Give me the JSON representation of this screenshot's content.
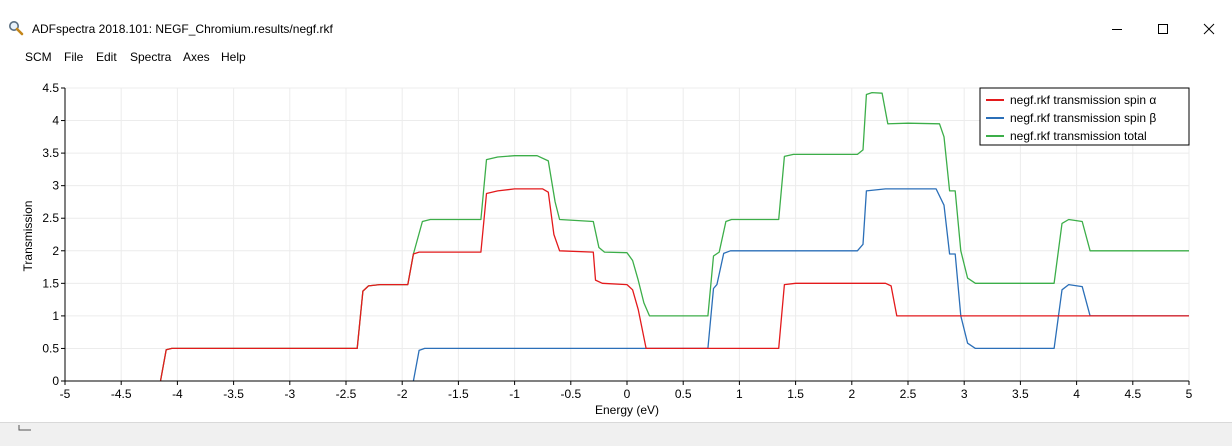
{
  "window": {
    "title": "ADFspectra 2018.101: NEGF_Chromium.results/negf.rkf",
    "icon": "magnifier-icon"
  },
  "menu": {
    "items": [
      {
        "label": "SCM"
      },
      {
        "label": "File"
      },
      {
        "label": "Edit"
      },
      {
        "label": "Spectra"
      },
      {
        "label": "Axes"
      },
      {
        "label": "Help"
      }
    ]
  },
  "chart_data": {
    "type": "line",
    "xlabel": "Energy (eV)",
    "ylabel": "Transmission",
    "xlim": [
      -5,
      5
    ],
    "ylim": [
      0,
      4.5
    ],
    "xticks": [
      -5,
      -4.5,
      -4,
      -3.5,
      -3,
      -2.5,
      -2,
      -1.5,
      -1,
      -0.5,
      0,
      0.5,
      1,
      1.5,
      2,
      2.5,
      3,
      3.5,
      4,
      4.5,
      5
    ],
    "xtick_labels": [
      "-5",
      "-4.5",
      "-4",
      "-3.5",
      "-3",
      "-2.5",
      "-2",
      "-1.5",
      "-1",
      "-0.5",
      "0",
      "0.5",
      "1",
      "1.5",
      "2",
      "2.5",
      "3",
      "3.5",
      "4",
      "4.5",
      "5"
    ],
    "yticks": [
      0,
      0.5,
      1,
      1.5,
      2,
      2.5,
      3,
      3.5,
      4,
      4.5
    ],
    "ytick_labels": [
      "0",
      "0.5",
      "1",
      "1.5",
      "2",
      "2.5",
      "3",
      "3.5",
      "4",
      "4.5"
    ],
    "grid": true,
    "legend_position": "top-right",
    "series": [
      {
        "name": "negf.rkf transmission spin α",
        "color": "#e31a1c",
        "points": [
          [
            -4.15,
            0
          ],
          [
            -4.1,
            0.48
          ],
          [
            -4.05,
            0.5
          ],
          [
            -2.4,
            0.5
          ],
          [
            -2.35,
            1.38
          ],
          [
            -2.3,
            1.46
          ],
          [
            -2.2,
            1.48
          ],
          [
            -1.95,
            1.48
          ],
          [
            -1.9,
            1.95
          ],
          [
            -1.85,
            1.98
          ],
          [
            -1.3,
            1.98
          ],
          [
            -1.25,
            2.88
          ],
          [
            -1.15,
            2.92
          ],
          [
            -1.0,
            2.95
          ],
          [
            -0.75,
            2.95
          ],
          [
            -0.7,
            2.9
          ],
          [
            -0.65,
            2.25
          ],
          [
            -0.6,
            2.0
          ],
          [
            -0.3,
            1.98
          ],
          [
            -0.28,
            1.55
          ],
          [
            -0.22,
            1.5
          ],
          [
            0.0,
            1.48
          ],
          [
            0.05,
            1.4
          ],
          [
            0.1,
            1.1
          ],
          [
            0.17,
            0.5
          ],
          [
            1.35,
            0.5
          ],
          [
            1.4,
            1.48
          ],
          [
            1.5,
            1.5
          ],
          [
            2.3,
            1.5
          ],
          [
            2.35,
            1.46
          ],
          [
            2.4,
            1.0
          ],
          [
            3.5,
            1.0
          ],
          [
            5.0,
            1.0
          ]
        ]
      },
      {
        "name": "negf.rkf transmission spin β",
        "color": "#2b6fb8",
        "points": [
          [
            -1.9,
            0
          ],
          [
            -1.85,
            0.47
          ],
          [
            -1.8,
            0.5
          ],
          [
            0.72,
            0.5
          ],
          [
            0.77,
            1.42
          ],
          [
            0.8,
            1.48
          ],
          [
            0.86,
            1.96
          ],
          [
            0.92,
            2.0
          ],
          [
            2.05,
            2.0
          ],
          [
            2.1,
            2.1
          ],
          [
            2.13,
            2.92
          ],
          [
            2.3,
            2.95
          ],
          [
            2.5,
            2.95
          ],
          [
            2.75,
            2.95
          ],
          [
            2.82,
            2.7
          ],
          [
            2.87,
            1.95
          ],
          [
            2.92,
            1.95
          ],
          [
            2.97,
            1.0
          ],
          [
            3.03,
            0.58
          ],
          [
            3.1,
            0.5
          ],
          [
            3.8,
            0.5
          ],
          [
            3.87,
            1.4
          ],
          [
            3.93,
            1.48
          ],
          [
            4.05,
            1.45
          ],
          [
            4.12,
            1.0
          ],
          [
            5.0,
            1.0
          ]
        ]
      },
      {
        "name": "negf.rkf transmission total",
        "color": "#3cae49",
        "points": [
          [
            -4.15,
            0
          ],
          [
            -4.1,
            0.48
          ],
          [
            -4.05,
            0.5
          ],
          [
            -2.4,
            0.5
          ],
          [
            -2.35,
            1.38
          ],
          [
            -2.3,
            1.46
          ],
          [
            -2.2,
            1.48
          ],
          [
            -1.95,
            1.48
          ],
          [
            -1.9,
            1.95
          ],
          [
            -1.82,
            2.45
          ],
          [
            -1.75,
            2.48
          ],
          [
            -1.3,
            2.48
          ],
          [
            -1.25,
            3.4
          ],
          [
            -1.15,
            3.44
          ],
          [
            -1.0,
            3.46
          ],
          [
            -0.8,
            3.46
          ],
          [
            -0.7,
            3.38
          ],
          [
            -0.64,
            2.75
          ],
          [
            -0.6,
            2.48
          ],
          [
            -0.3,
            2.45
          ],
          [
            -0.25,
            2.05
          ],
          [
            -0.2,
            1.98
          ],
          [
            0.0,
            1.97
          ],
          [
            0.05,
            1.85
          ],
          [
            0.1,
            1.55
          ],
          [
            0.15,
            1.2
          ],
          [
            0.2,
            1.0
          ],
          [
            0.72,
            1.0
          ],
          [
            0.77,
            1.92
          ],
          [
            0.82,
            1.98
          ],
          [
            0.88,
            2.45
          ],
          [
            0.93,
            2.48
          ],
          [
            1.35,
            2.48
          ],
          [
            1.4,
            3.45
          ],
          [
            1.48,
            3.48
          ],
          [
            2.05,
            3.48
          ],
          [
            2.1,
            3.55
          ],
          [
            2.13,
            4.4
          ],
          [
            2.18,
            4.43
          ],
          [
            2.27,
            4.42
          ],
          [
            2.32,
            3.95
          ],
          [
            2.5,
            3.96
          ],
          [
            2.78,
            3.95
          ],
          [
            2.82,
            3.75
          ],
          [
            2.87,
            2.92
          ],
          [
            2.92,
            2.92
          ],
          [
            2.97,
            2.0
          ],
          [
            3.03,
            1.58
          ],
          [
            3.1,
            1.5
          ],
          [
            3.8,
            1.5
          ],
          [
            3.87,
            2.42
          ],
          [
            3.93,
            2.48
          ],
          [
            4.05,
            2.45
          ],
          [
            4.12,
            2.0
          ],
          [
            5.0,
            2.0
          ]
        ]
      }
    ]
  }
}
